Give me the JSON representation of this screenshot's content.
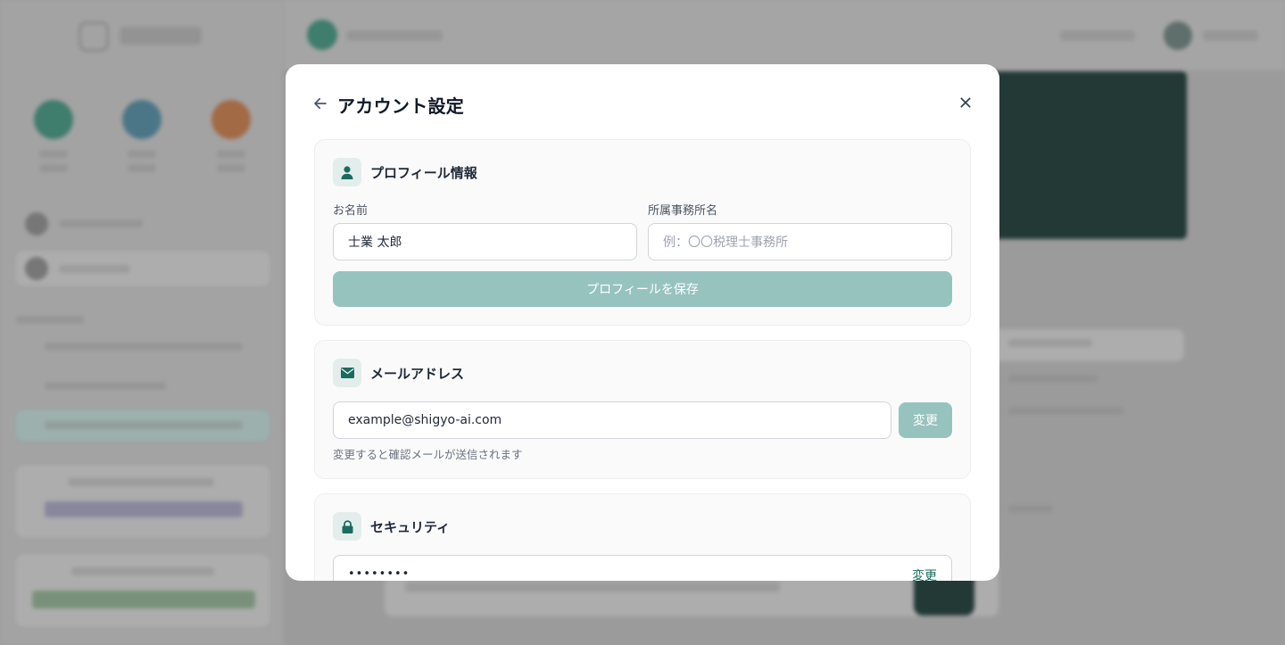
{
  "modal": {
    "title": "アカウント設定",
    "back_icon": "arrow-left-icon",
    "close_icon": "close-icon"
  },
  "profile": {
    "title": "プロフィール情報",
    "icon": "user-icon",
    "name_label": "お名前",
    "name_value": "士業 太郎",
    "office_label": "所属事務所名",
    "office_placeholder": "例：〇〇税理士事務所",
    "save_label": "プロフィールを保存"
  },
  "email": {
    "title": "メールアドレス",
    "icon": "envelope-icon",
    "value": "example@shigyo-ai.com",
    "change_label": "変更",
    "help": "変更すると確認メールが送信されます"
  },
  "security": {
    "title": "セキュリティ",
    "icon": "lock-icon",
    "password_mask": "••••••••",
    "change_label": "変更"
  },
  "colors": {
    "accent": "#1a6b5f",
    "button_disabled": "#97c3bf",
    "icon_bg": "#e3eeec",
    "overlay": "#9e9e9e"
  }
}
